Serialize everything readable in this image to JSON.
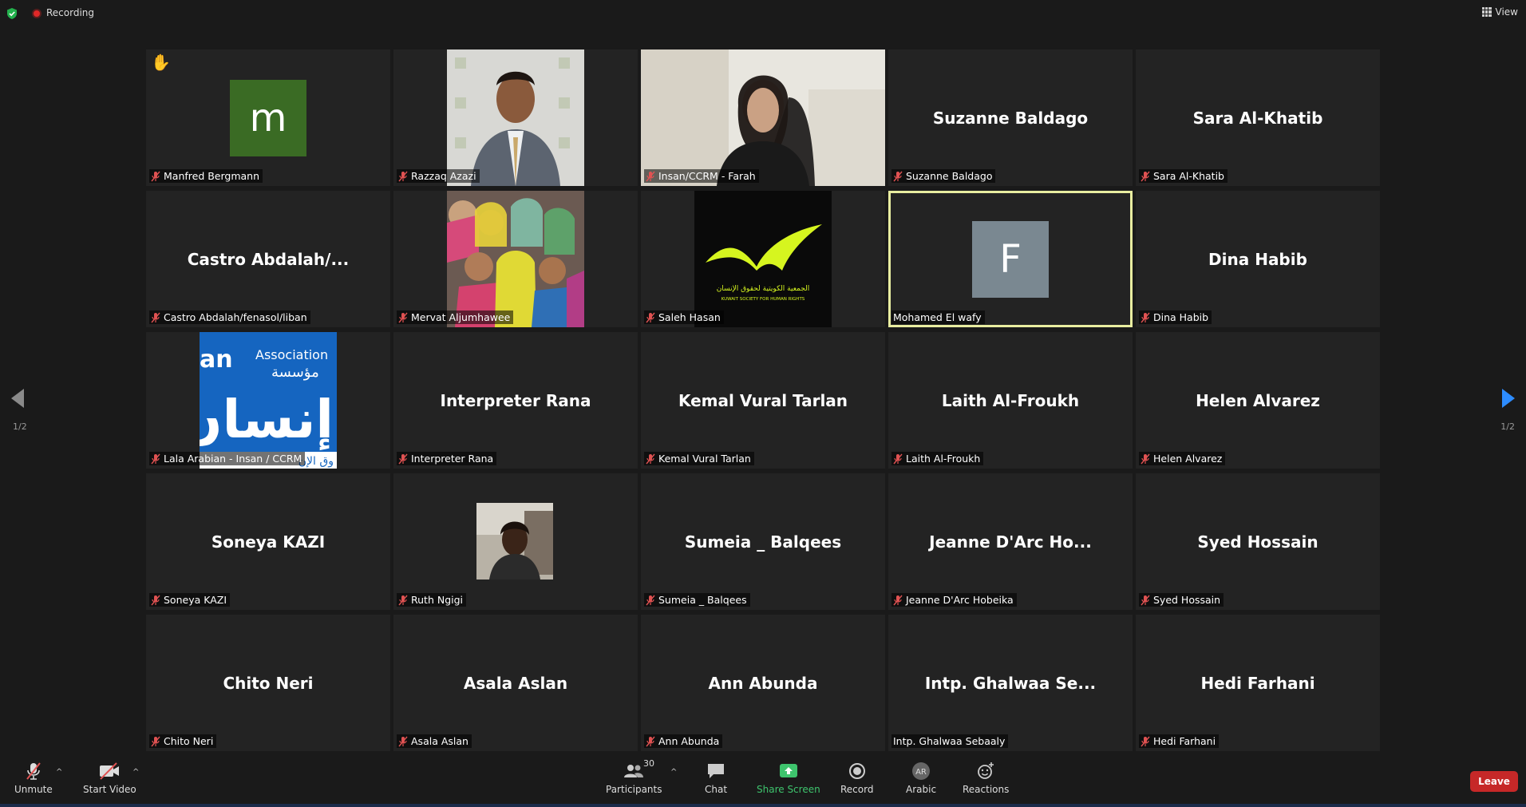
{
  "topbar": {
    "recording_label": "Recording",
    "view_label": "View"
  },
  "gallery": {
    "tiles": [
      {
        "label": "Manfred Bergmann",
        "avatar_letter": "m"
      },
      {
        "label": "Razzaq Azazi"
      },
      {
        "label": "Insan/CCRM - Farah"
      },
      {
        "label": "Suzanne Baldago",
        "display": "Suzanne Baldago"
      },
      {
        "label": "Sara Al-Khatib",
        "display": "Sara Al-Khatib"
      },
      {
        "label": "Castro Abdalah/fenasol/liban",
        "display": "Castro  Abdalah/..."
      },
      {
        "label": "Mervat Aljumhawee"
      },
      {
        "label": "Saleh Hasan",
        "logo_ar": "الجمعية الكويتية لحقوق الإنسان",
        "logo_en": "KUWAIT SOCIETY FOR HUMAN RIGHTS"
      },
      {
        "label": "Mohamed El wafy",
        "avatar_letter": "F"
      },
      {
        "label": "Dina Habib",
        "display": "Dina Habib"
      },
      {
        "label": "Lala Arabian - Insan / CCRM",
        "logo_en": "Association",
        "logo_ar_top": "مؤسسة",
        "logo_ar_big": "إنسان",
        "logo_partial": "an",
        "logo_bottom_ar": "وق الإن"
      },
      {
        "label": "Interpreter Rana",
        "display": "Interpreter Rana"
      },
      {
        "label": "Kemal Vural Tarlan",
        "display": "Kemal Vural Tarlan"
      },
      {
        "label": "Laith Al-Froukh",
        "display": "Laith Al-Froukh"
      },
      {
        "label": "Helen Alvarez",
        "display": "Helen Alvarez"
      },
      {
        "label": "Soneya KAZI",
        "display": "Soneya KAZI"
      },
      {
        "label": "Ruth Ngigi"
      },
      {
        "label": "Sumeia _ Balqees",
        "display": "Sumeia _ Balqees"
      },
      {
        "label": "Jeanne D'Arc Hobeika",
        "display": "Jeanne  D'Arc  Ho..."
      },
      {
        "label": "Syed Hossain",
        "display": "Syed Hossain"
      },
      {
        "label": "Chito Neri",
        "display": "Chito Neri"
      },
      {
        "label": "Asala Aslan",
        "display": "Asala Aslan"
      },
      {
        "label": "Ann Abunda",
        "display": "Ann Abunda"
      },
      {
        "label": "Intp. Ghalwaa Sebaaly",
        "display": "Intp. Ghalwaa Se..."
      },
      {
        "label": "Hedi Farhani",
        "display": "Hedi Farhani"
      }
    ]
  },
  "pager": {
    "left": "1/2",
    "right": "1/2"
  },
  "toolbar": {
    "unmute": "Unmute",
    "start_video": "Start Video",
    "participants": "Participants",
    "participants_count": "30",
    "chat": "Chat",
    "share_screen": "Share Screen",
    "record": "Record",
    "language": "Arabic",
    "language_code": "AR",
    "reactions": "Reactions",
    "leave": "Leave"
  },
  "colors": {
    "share_green": "#3ec46d",
    "leave_red": "#c62828",
    "active_speaker": "#e8eda0",
    "mute_red": "#e05252",
    "accent_blue": "#2d8cff"
  }
}
